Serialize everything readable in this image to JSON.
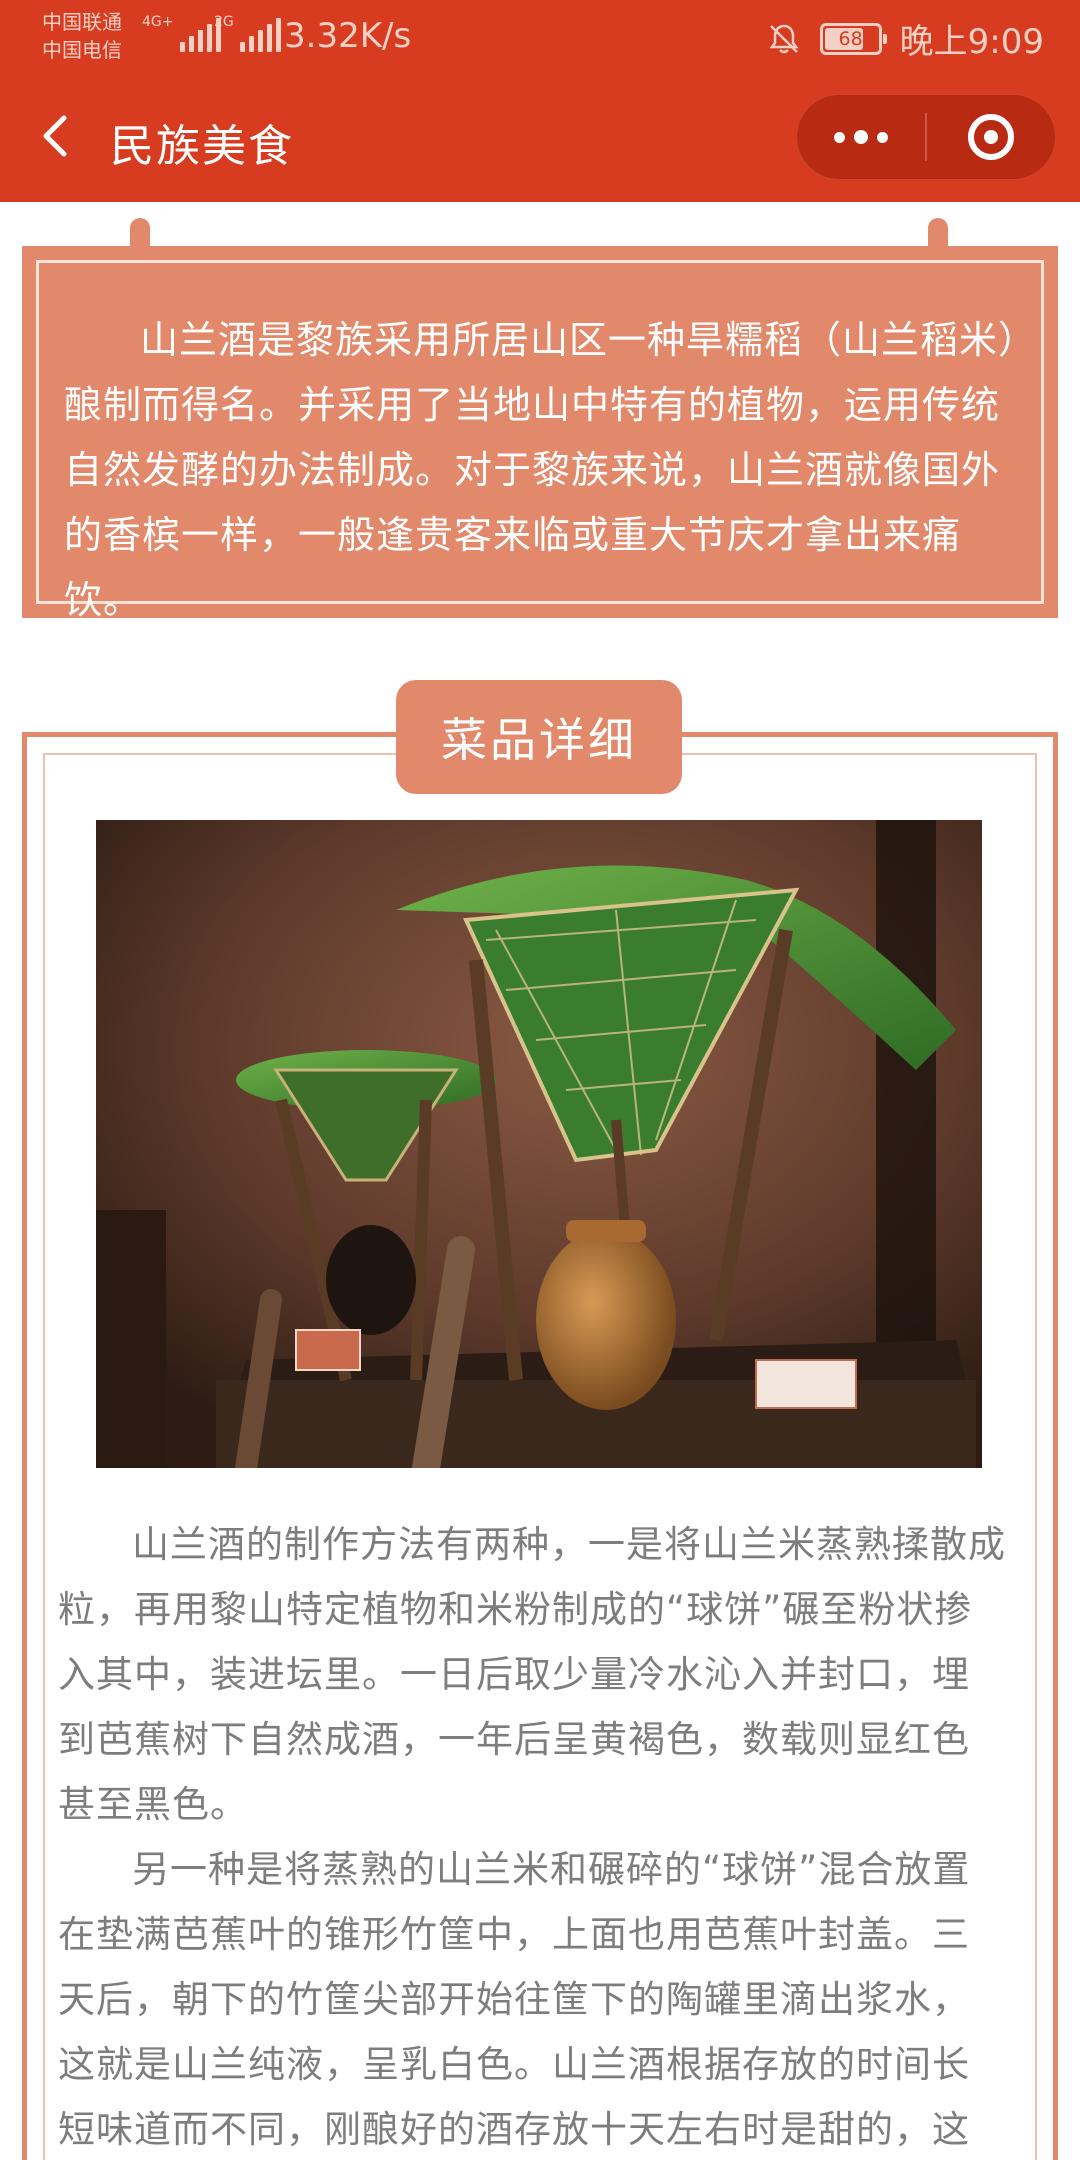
{
  "status_bar": {
    "carrier_1": "中国联通",
    "carrier_2": "中国电信",
    "net_1": "4G+",
    "net_2": "2G",
    "speed": "3.32K/s",
    "battery": "68",
    "time": "晚上9:09",
    "icons": [
      "signal-icon",
      "bell-off-icon",
      "battery-icon"
    ]
  },
  "title_bar": {
    "title": "民族美食",
    "icons": [
      "back-icon",
      "more-icon",
      "close-target-icon"
    ]
  },
  "intro": {
    "text": "山兰酒是黎族采用所居山区一种旱糯稻（山兰稻米）酿制而得名。并采用了当地山中特有的植物，运用传统自然发酵的办法制成。对于黎族来说，山兰酒就像国外的香槟一样，一般逢贵客来临或重大节庆才拿出来痛饮。"
  },
  "detail": {
    "section_title": "菜品详细",
    "paragraphs": [
      "山兰酒的制作方法有两种，一是将山兰米蒸熟揉散成粒，再用黎山特定植物和米粉制成的“球饼”碾至粉状掺入其中，装进坛里。一日后取少量冷水沁入并封口，埋到芭蕉树下自然成酒，一年后呈黄褐色，数载则显红色甚至黑色。",
      "另一种是将蒸熟的山兰米和碾碎的“球饼”混合放置在垫满芭蕉叶的锥形竹筐中，上面也用芭蕉叶封盖。三天后，朝下的竹筐尖部开始往筐下的陶罐里滴出浆水，这就是山兰纯液，呈乳白色。山兰酒根据存放的时间长短味道而不同，刚酿好的酒存放十天左右时是甜的，这时也是黎"
    ]
  },
  "colors": {
    "header": "#d83c20",
    "accent": "#e2896b",
    "body_text": "#7d7d7d"
  }
}
